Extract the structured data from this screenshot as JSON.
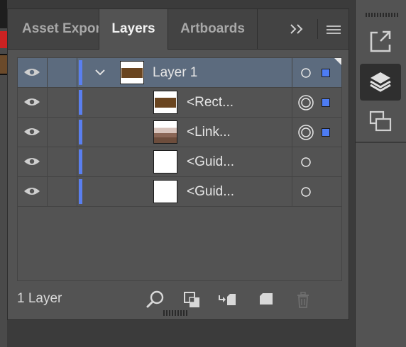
{
  "tabs": [
    {
      "label": "Asset Export",
      "active": false
    },
    {
      "label": "Layers",
      "active": true
    },
    {
      "label": "Artboards",
      "active": false
    }
  ],
  "tab_overflow_icon": "double-chevron-right-icon",
  "panel_menu_icon": "hamburger-menu-icon",
  "layers": [
    {
      "name": "Layer 1",
      "level": 0,
      "expanded": true,
      "selected": true,
      "thumbnail": "brown-rect",
      "target": "single",
      "has_selection": true
    },
    {
      "name": "<Rect...",
      "level": 1,
      "selected": false,
      "thumbnail": "brown-rect",
      "target": "double",
      "has_selection": true
    },
    {
      "name": "<Link...",
      "level": 1,
      "selected": false,
      "thumbnail": "photo",
      "target": "double",
      "has_selection": true
    },
    {
      "name": "<Guid...",
      "level": 1,
      "selected": false,
      "thumbnail": "blank",
      "target": "single",
      "has_selection": false
    },
    {
      "name": "<Guid...",
      "level": 1,
      "selected": false,
      "thumbnail": "blank",
      "target": "single",
      "has_selection": false
    }
  ],
  "footer": {
    "layer_count": "1 Layer",
    "actions": [
      {
        "name": "locate-object-icon"
      },
      {
        "name": "make-clipping-mask-icon"
      },
      {
        "name": "create-sublayer-icon"
      },
      {
        "name": "create-new-layer-icon"
      },
      {
        "name": "delete-layer-icon",
        "disabled": true
      }
    ]
  },
  "dock": {
    "buttons": [
      {
        "name": "asset-export-icon",
        "active": false
      },
      {
        "name": "layers-icon",
        "active": true
      },
      {
        "name": "artboards-icon",
        "active": false
      }
    ]
  },
  "colors": {
    "layer_color": "#5a7ff0",
    "selection_square": "#4d7cf3",
    "selected_row": "#5c6b7e",
    "panel_bg": "#535353"
  }
}
